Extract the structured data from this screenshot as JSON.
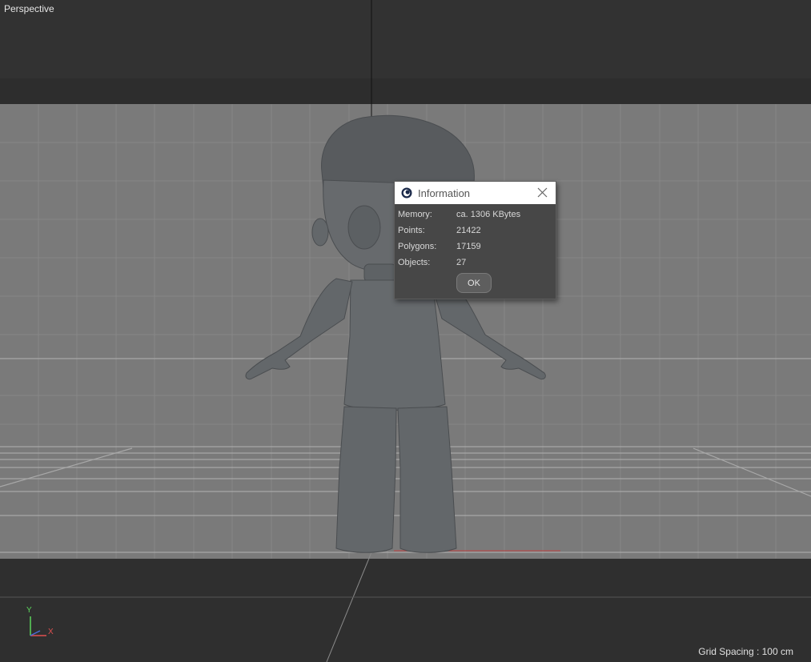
{
  "viewport": {
    "label": "Perspective",
    "grid_spacing": "Grid Spacing : 100 cm",
    "axis": {
      "y": "Y",
      "x": "X"
    }
  },
  "dialog": {
    "title": "Information",
    "rows": [
      {
        "key": "Memory:",
        "value": "ca. 1306 KBytes"
      },
      {
        "key": "Points:",
        "value": "21422"
      },
      {
        "key": "Polygons:",
        "value": "17159"
      },
      {
        "key": "Objects:",
        "value": "27"
      }
    ],
    "ok_label": "OK"
  },
  "colors": {
    "axis_x": "#e05050",
    "axis_y": "#5cd65c",
    "axis_z": "#4a6cd6"
  },
  "icons": {
    "dialog_logo": "cinema4d-logo-icon",
    "close": "close-icon"
  }
}
